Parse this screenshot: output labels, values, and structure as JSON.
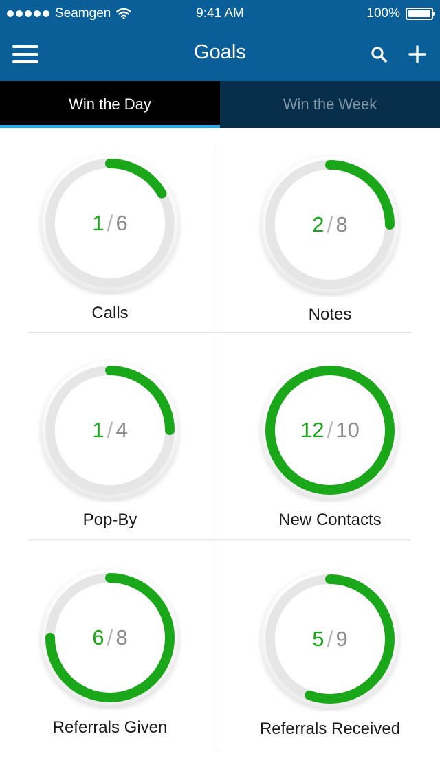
{
  "status_bar": {
    "carrier": "Seamgen",
    "time": "9:41 AM",
    "battery": "100%"
  },
  "nav": {
    "title": "Goals",
    "menu_icon": "hamburger-menu-icon",
    "search_icon": "search-icon",
    "add_icon": "plus-icon"
  },
  "tabs": [
    {
      "label": "Win the Day",
      "active": true
    },
    {
      "label": "Win the Week",
      "active": false
    }
  ],
  "goals": [
    {
      "label": "Calls",
      "current": "1",
      "target": "6",
      "progress": 0.1667
    },
    {
      "label": "Notes",
      "current": "2",
      "target": "8",
      "progress": 0.25
    },
    {
      "label": "Pop-By",
      "current": "1",
      "target": "4",
      "progress": 0.25
    },
    {
      "label": "New Contacts",
      "current": "12",
      "target": "10",
      "progress": 1.0
    },
    {
      "label": "Referrals Given",
      "current": "6",
      "target": "8",
      "progress": 0.75
    },
    {
      "label": "Referrals Received",
      "current": "5",
      "target": "9",
      "progress": 0.5556
    }
  ],
  "colors": {
    "header": "#0b5f98",
    "tab_active": "#000000",
    "tab_inactive": "#072f4b",
    "tab_indicator": "#26a9e8",
    "progress": "#1aa81a",
    "track": "#e6e6e6"
  }
}
